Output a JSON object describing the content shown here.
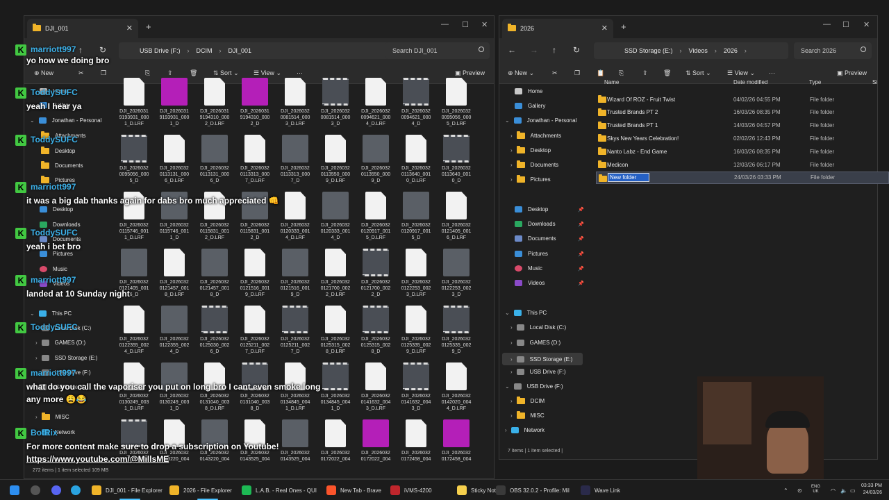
{
  "left_window": {
    "tab_title": "DJI_001",
    "breadcrumbs": [
      "USB Drive (F:)",
      "DCIM",
      "DJI_001"
    ],
    "search_placeholder": "Search DJI_001",
    "toolbar": {
      "new": "New",
      "sort": "Sort",
      "view": "View",
      "more": "···",
      "preview": "Preview"
    },
    "sidebar": {
      "home": "Home",
      "gallery": "Gallery",
      "personal": "Jonathan - Personal",
      "attachments": "Attachments",
      "desktop": "Desktop",
      "documents": "Documents",
      "pictures": "Pictures",
      "desktop2": "Desktop",
      "downloads": "Downloads",
      "documents2": "Documents",
      "pictures2": "Pictures",
      "music": "Music",
      "videos": "Videos",
      "this_pc": "This PC",
      "local_disk": "Local Disk (C:)",
      "games": "GAMES (D:)",
      "ssd": "SSD Storage (E:)",
      "usb": "USB Drive (F:)",
      "usb2": "USB Drive (F:)",
      "misc": "MISC",
      "network": "Network"
    },
    "files": [
      {
        "l1": "DJI_2026031",
        "l2": "9193931_000",
        "l3": "1_D.LRF",
        "t": "doc"
      },
      {
        "l1": "DJI_2026031",
        "l2": "9193931_000",
        "l3": "1_D",
        "t": "pink"
      },
      {
        "l1": "DJI_2026031",
        "l2": "9194310_000",
        "l3": "2_D.LRF",
        "t": "doc"
      },
      {
        "l1": "DJI_2026031",
        "l2": "9194310_000",
        "l3": "2_D",
        "t": "pink"
      },
      {
        "l1": "DJI_2026032",
        "l2": "0081514_000",
        "l3": "3_D.LRF",
        "t": "doc"
      },
      {
        "l1": "DJI_2026032",
        "l2": "0081514_000",
        "l3": "3_D",
        "t": "vid"
      },
      {
        "l1": "DJI_2026032",
        "l2": "0094621_000",
        "l3": "4_D.LRF",
        "t": "doc"
      },
      {
        "l1": "DJI_2026032",
        "l2": "0094621_000",
        "l3": "4_D",
        "t": "vid"
      },
      {
        "l1": "DJI_2026032",
        "l2": "0095056_000",
        "l3": "5_D.LRF",
        "t": "doc"
      },
      {
        "l1": "DJI_2026032",
        "l2": "0095056_000",
        "l3": "5_D",
        "t": "vid"
      },
      {
        "l1": "DJI_2026032",
        "l2": "0113131_000",
        "l3": "6_D.LRF",
        "t": "doc"
      },
      {
        "l1": "DJI_2026032",
        "l2": "0113131_000",
        "l3": "6_D",
        "t": "img"
      },
      {
        "l1": "DJI_2026032",
        "l2": "0113313_000",
        "l3": "7_D.LRF",
        "t": "doc"
      },
      {
        "l1": "DJI_2026032",
        "l2": "0113313_000",
        "l3": "7_D",
        "t": "img"
      },
      {
        "l1": "DJI_2026032",
        "l2": "0113550_000",
        "l3": "9_D.LRF",
        "t": "doc"
      },
      {
        "l1": "DJI_2026032",
        "l2": "0113550_000",
        "l3": "9_D",
        "t": "img"
      },
      {
        "l1": "DJI_2026032",
        "l2": "0113640_001",
        "l3": "0_D.LRF",
        "t": "doc"
      },
      {
        "l1": "DJI_2026032",
        "l2": "0113640_001",
        "l3": "0_D",
        "t": "vid"
      },
      {
        "l1": "DJI_2026032",
        "l2": "0115746_001",
        "l3": "1_D.LRF",
        "t": "doc"
      },
      {
        "l1": "DJI_2026032",
        "l2": "0115746_001",
        "l3": "1_D",
        "t": "img"
      },
      {
        "l1": "DJI_2026032",
        "l2": "0115831_001",
        "l3": "2_D.LRF",
        "t": "doc"
      },
      {
        "l1": "DJI_2026032",
        "l2": "0115831_001",
        "l3": "2_D",
        "t": "img"
      },
      {
        "l1": "DJI_2026032",
        "l2": "0120333_001",
        "l3": "4_D.LRF",
        "t": "doc"
      },
      {
        "l1": "DJI_2026032",
        "l2": "0120333_001",
        "l3": "4_D",
        "t": "img"
      },
      {
        "l1": "DJI_2026032",
        "l2": "0120917_001",
        "l3": "5_D.LRF",
        "t": "doc"
      },
      {
        "l1": "DJI_2026032",
        "l2": "0120917_001",
        "l3": "5_D",
        "t": "img"
      },
      {
        "l1": "DJI_2026032",
        "l2": "0121405_001",
        "l3": "6_D.LRF",
        "t": "doc"
      },
      {
        "l1": "DJI_2026032",
        "l2": "0121405_001",
        "l3": "6_D",
        "t": "img"
      },
      {
        "l1": "DJI_2026032",
        "l2": "0121457_001",
        "l3": "8_D.LRF",
        "t": "doc"
      },
      {
        "l1": "DJI_2026032",
        "l2": "0121457_001",
        "l3": "8_D",
        "t": "img"
      },
      {
        "l1": "DJI_2026032",
        "l2": "0121516_001",
        "l3": "9_D.LRF",
        "t": "doc"
      },
      {
        "l1": "DJI_2026032",
        "l2": "0121516_001",
        "l3": "9_D",
        "t": "img"
      },
      {
        "l1": "DJI_2026032",
        "l2": "0121700_002",
        "l3": "2_D.LRF",
        "t": "doc"
      },
      {
        "l1": "DJI_2026032",
        "l2": "0121700_002",
        "l3": "2_D",
        "t": "vid"
      },
      {
        "l1": "DJI_2026032",
        "l2": "0122253_002",
        "l3": "3_D.LRF",
        "t": "doc"
      },
      {
        "l1": "DJI_2026032",
        "l2": "0122253_002",
        "l3": "3_D",
        "t": "img"
      },
      {
        "l1": "DJI_2026032",
        "l2": "0122355_002",
        "l3": "4_D.LRF",
        "t": "doc"
      },
      {
        "l1": "DJI_2026032",
        "l2": "0122355_002",
        "l3": "4_D",
        "t": "img"
      },
      {
        "l1": "DJI_2026032",
        "l2": "0125030_002",
        "l3": "6_D",
        "t": "vid"
      },
      {
        "l1": "DJI_2026032",
        "l2": "0125211_002",
        "l3": "7_D.LRF",
        "t": "doc"
      },
      {
        "l1": "DJI_2026032",
        "l2": "0125211_002",
        "l3": "7_D",
        "t": "vid"
      },
      {
        "l1": "DJI_2026032",
        "l2": "0125315_002",
        "l3": "8_D.LRF",
        "t": "doc"
      },
      {
        "l1": "DJI_2026032",
        "l2": "0125315_002",
        "l3": "8_D",
        "t": "vid"
      },
      {
        "l1": "DJI_2026032",
        "l2": "0125335_002",
        "l3": "9_D.LRF",
        "t": "doc"
      },
      {
        "l1": "DJI_2026032",
        "l2": "0125335_002",
        "l3": "9_D",
        "t": "vid"
      },
      {
        "l1": "DJI_2026032",
        "l2": "0130249_003",
        "l3": "1_D.LRF",
        "t": "doc"
      },
      {
        "l1": "DJI_2026032",
        "l2": "0130249_003",
        "l3": "1_D",
        "t": "img"
      },
      {
        "l1": "DJI_2026032",
        "l2": "0131040_003",
        "l3": "8_D.LRF",
        "t": "doc"
      },
      {
        "l1": "DJI_2026032",
        "l2": "0131040_003",
        "l3": "8_D",
        "t": "vid"
      },
      {
        "l1": "DJI_2026032",
        "l2": "0134845_004",
        "l3": "1_D.LRF",
        "t": "doc"
      },
      {
        "l1": "DJI_2026032",
        "l2": "0134845_004",
        "l3": "1_D",
        "t": "vid"
      },
      {
        "l1": "DJI_2026032",
        "l2": "0141632_004",
        "l3": "3_D.LRF",
        "t": "doc"
      },
      {
        "l1": "DJI_2026032",
        "l2": "0141632_004",
        "l3": "3_D",
        "t": "vid"
      },
      {
        "l1": "DJI_2026032",
        "l2": "0142020_004",
        "l3": "4_D.LRF",
        "t": "doc"
      },
      {
        "l1": "DJI_2026032",
        "l2": "0142020_004",
        "l3": "",
        "t": "vid"
      },
      {
        "l1": "DJI_2026032",
        "l2": "0143220_004",
        "l3": "",
        "t": "doc"
      },
      {
        "l1": "DJI_2026032",
        "l2": "0143220_004",
        "l3": "",
        "t": "img"
      },
      {
        "l1": "DJI_2026032",
        "l2": "0143525_004",
        "l3": "",
        "t": "doc"
      },
      {
        "l1": "DJI_2026032",
        "l2": "0143525_004",
        "l3": "",
        "t": "img"
      },
      {
        "l1": "DJI_2026032",
        "l2": "0172022_004",
        "l3": "",
        "t": "doc"
      },
      {
        "l1": "DJI_2026032",
        "l2": "0172022_004",
        "l3": "",
        "t": "pink"
      },
      {
        "l1": "DJI_2026032",
        "l2": "0172458_004",
        "l3": "",
        "t": "doc"
      },
      {
        "l1": "DJI_2026032",
        "l2": "0172458_004",
        "l3": "",
        "t": "pink"
      }
    ],
    "status": "272 items  |  1 item selected  109 MB"
  },
  "right_window": {
    "tab_title": "2026",
    "breadcrumbs": [
      "SSD Storage (E:)",
      "Videos",
      "2026"
    ],
    "search_placeholder": "Search 2026",
    "toolbar": {
      "new": "New",
      "sort": "Sort",
      "view": "View",
      "more": "···",
      "preview": "Preview"
    },
    "sidebar": {
      "home": "Home",
      "gallery": "Gallery",
      "personal": "Jonathan - Personal",
      "attachments": "Attachments",
      "desktop": "Desktop",
      "documents": "Documents",
      "pictures": "Pictures",
      "desktop2": "Desktop",
      "downloads": "Downloads",
      "documents2": "Documents",
      "pictures2": "Pictures",
      "music": "Music",
      "videos": "Videos",
      "this_pc": "This PC",
      "local_disk": "Local Disk (C:)",
      "games": "GAMES (D:)",
      "ssd": "SSD Storage (E:)",
      "usb": "USB Drive (F:)",
      "usb2": "USB Drive (F:)",
      "dcim": "DCIM",
      "misc": "MISC",
      "network": "Network"
    },
    "columns": {
      "name": "Name",
      "date": "Date modified",
      "type": "Type",
      "size": "Si"
    },
    "rows": [
      {
        "name": "Wizard Of ROZ - Fruit Twist",
        "date": "04/02/26 04:55 PM",
        "type": "File folder"
      },
      {
        "name": "Trusted Brands PT 2",
        "date": "16/03/26 08:35 PM",
        "type": "File folder"
      },
      {
        "name": "Trusted Brands PT 1",
        "date": "14/03/26 04:57 PM",
        "type": "File folder"
      },
      {
        "name": "Skys New Years Celebration!",
        "date": "02/02/26 12:43 PM",
        "type": "File folder"
      },
      {
        "name": "Nanto Labz - End Game",
        "date": "16/03/26 08:35 PM",
        "type": "File folder"
      },
      {
        "name": "Medicon",
        "date": "12/03/26 06:17 PM",
        "type": "File folder"
      },
      {
        "name": "New folder",
        "date": "24/03/26 03:33 PM",
        "type": "File folder"
      }
    ],
    "status": "7 items  |  1 item selected  |"
  },
  "chat": {
    "messages": [
      {
        "user": "marriott997",
        "text": "yo how we doing bro"
      },
      {
        "user": "ToddySUFC",
        "text": "yeah I hear ya"
      },
      {
        "user": "ToddySUFC",
        "text": ""
      },
      {
        "user": "marriott997",
        "text": "it was a big dab thanks again for dabs bro much appreciated 👊"
      },
      {
        "user": "ToddySUFC",
        "text": "yeah i bet bro"
      },
      {
        "user": "marriott997",
        "text": "landed at 10 Sunday night"
      },
      {
        "user": "ToddySUFC",
        "text": ""
      },
      {
        "user": "marriott997",
        "text": "what do you call the vaporiser you put on long bro I cant even smoke long"
      },
      {
        "user": "",
        "text": "any more 😩😂"
      },
      {
        "user": "BotRix",
        "text": "For more content make sure to drop a subscription on Youtube!"
      },
      {
        "user": "",
        "text": "https://www.youtube.com/@MillsME"
      }
    ]
  },
  "taskbar": {
    "items": [
      {
        "label": "DJI_001 - File Explorer",
        "color": "#f0b429"
      },
      {
        "label": "2026 - File Explorer",
        "color": "#f0b429"
      },
      {
        "label": "L.A.B. - Real Ones - QUI",
        "color": "#1db954"
      },
      {
        "label": "New Tab - Brave",
        "color": "#fb542b"
      },
      {
        "label": "iVMS-4200",
        "color": "#c0262c"
      },
      {
        "label": "Sticky Notes",
        "color": "#f6d04d"
      },
      {
        "label": "OBS 32.0.2 - Profile: Mil",
        "color": "#3a3a3a"
      },
      {
        "label": "Wave Link",
        "color": "#2a2a4a"
      }
    ],
    "lang": "ENG",
    "region": "UK",
    "time": "03:33 PM",
    "date": "24/03/26"
  }
}
